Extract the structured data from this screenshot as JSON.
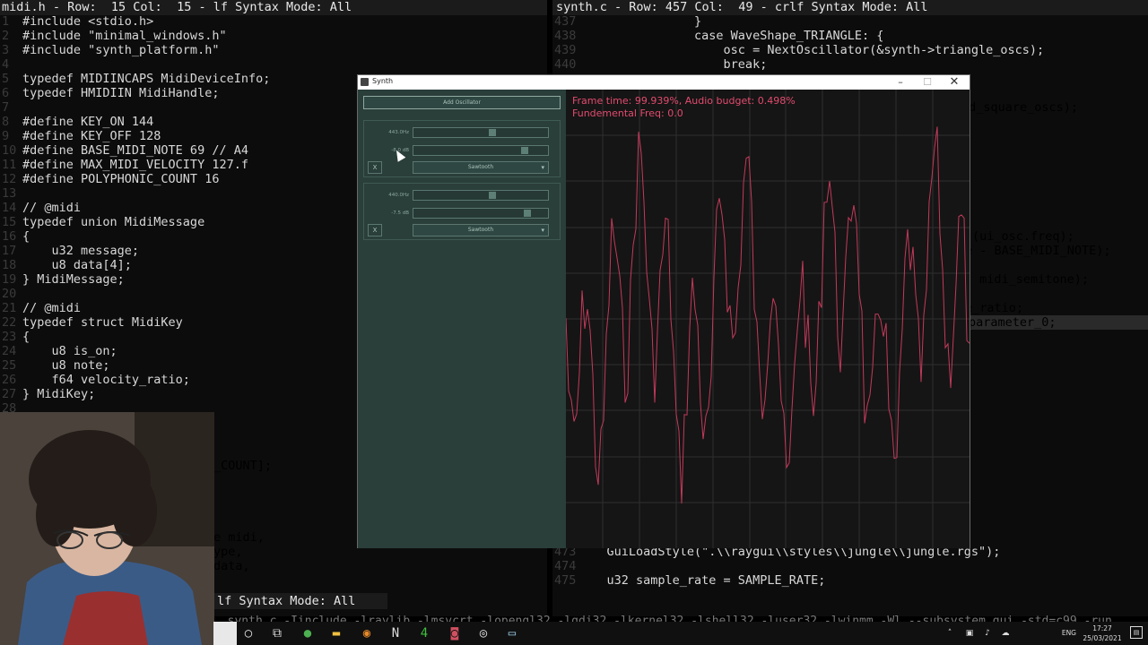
{
  "left_editor": {
    "status": "midi.h - Row:  15 Col:  15 - lf Syntax Mode: All",
    "lines": [
      {
        "n": "1",
        "code": "#include <stdio.h>"
      },
      {
        "n": "2",
        "code": "#include \"minimal_windows.h\""
      },
      {
        "n": "3",
        "code": "#include \"synth_platform.h\""
      },
      {
        "n": "4",
        "code": ""
      },
      {
        "n": "5",
        "code": "typedef MIDIINCAPS MidiDeviceInfo;"
      },
      {
        "n": "6",
        "code": "typedef HMIDIIN MidiHandle;"
      },
      {
        "n": "7",
        "code": ""
      },
      {
        "n": "8",
        "code": "#define KEY_ON 144"
      },
      {
        "n": "9",
        "code": "#define KEY_OFF 128"
      },
      {
        "n": "10",
        "code": "#define BASE_MIDI_NOTE 69 // A4"
      },
      {
        "n": "11",
        "code": "#define MAX_MIDI_VELOCITY 127.f"
      },
      {
        "n": "12",
        "code": "#define POLYPHONIC_COUNT 16"
      },
      {
        "n": "13",
        "code": ""
      },
      {
        "n": "14",
        "code": "// @midi"
      },
      {
        "n": "15",
        "code": "typedef union MidiMessage"
      },
      {
        "n": "16",
        "code": "{"
      },
      {
        "n": "17",
        "code": "    u32 message;"
      },
      {
        "n": "18",
        "code": "    u8 data[4];"
      },
      {
        "n": "19",
        "code": "} MidiMessage;"
      },
      {
        "n": "20",
        "code": ""
      },
      {
        "n": "21",
        "code": "// @midi"
      },
      {
        "n": "22",
        "code": "typedef struct MidiKey"
      },
      {
        "n": "23",
        "code": "{"
      },
      {
        "n": "24",
        "code": "    u8 is_on;"
      },
      {
        "n": "25",
        "code": "    u8 note;"
      },
      {
        "n": "26",
        "code": "    f64 velocity_ratio;"
      },
      {
        "n": "27",
        "code": "} MidiKey;"
      },
      {
        "n": "28",
        "code": ""
      }
    ],
    "partial_lines": [
      {
        "text": "_COUNT];"
      },
      {
        "text": "e midi,"
      },
      {
        "text": "ype,"
      },
      {
        "text": "data,"
      }
    ],
    "bottom_status": "lf Syntax Mode: All"
  },
  "right_editor": {
    "status": "synth.c - Row: 457 Col:  49 - crlf Syntax Mode: All",
    "lines": [
      {
        "n": "437",
        "code": "                }"
      },
      {
        "n": "438",
        "code": "                case WaveShape_TRIANGLE: {"
      },
      {
        "n": "439",
        "code": "                    osc = NextOscillator(&synth->triangle_oscs);"
      },
      {
        "n": "440",
        "code": "                    break;"
      }
    ],
    "hidden_fragments": [
      {
        "text": "ed_square_oscs);"
      },
      {
        "text": "(ui_osc.freq);"
      },
      {
        "text": "e - BASE_MIDI_NOTE);"
      },
      {
        "text": " midi_semitone);"
      },
      {
        "text": "e_ratio;"
      },
      {
        "text": "parameter_0;"
      }
    ],
    "bottom_lines": [
      {
        "n": "473",
        "code": "    GuiLoadStyle(\".\\\\raygui\\\\styles\\\\jungle\\\\jungle.rgs\");"
      },
      {
        "n": "474",
        "code": ""
      },
      {
        "n": "475",
        "code": "    u32 sample_rate = SAMPLE_RATE;"
      }
    ]
  },
  "bottom_code": "  synth.c -Iinclude -lraylib -lmsvcrt -lopengl32 -lgdi32 -lkernel32 -lshell32 -luser32 -lwinmm -Wl,--subsystem,gui -std=c99 -run",
  "synth": {
    "title": "Synth",
    "add_button": "Add Oscillator",
    "oscillators": [
      {
        "freq_label": "443.0Hz",
        "gain_label": "-8.0 dB",
        "freq": 0.6,
        "gain": 0.86,
        "remove": "X",
        "shape": "Sawtooth"
      },
      {
        "freq_label": "440.0Hz",
        "gain_label": "-7.5 dB",
        "freq": 0.6,
        "gain": 0.88,
        "remove": "X",
        "shape": "Sawtooth"
      }
    ],
    "overlay_line1": "Frame time: 99.939%, Audio budget: 0.498%",
    "overlay_line2": "Fundemental Freq: 0.0",
    "colors": {
      "panel": "#2a3e3a",
      "wave": "#c23a5a",
      "overlay": "#e34b6e"
    }
  },
  "taskbar": {
    "time": "17:27",
    "date": "25/03/2021",
    "lang": "ENG",
    "icons": [
      "search-icon",
      "task-view-icon",
      "chrome-icon",
      "explorer-icon",
      "blender-icon",
      "notion-icon",
      "4coder-icon",
      "outlook-icon",
      "obs-icon",
      "synth-icon"
    ]
  }
}
